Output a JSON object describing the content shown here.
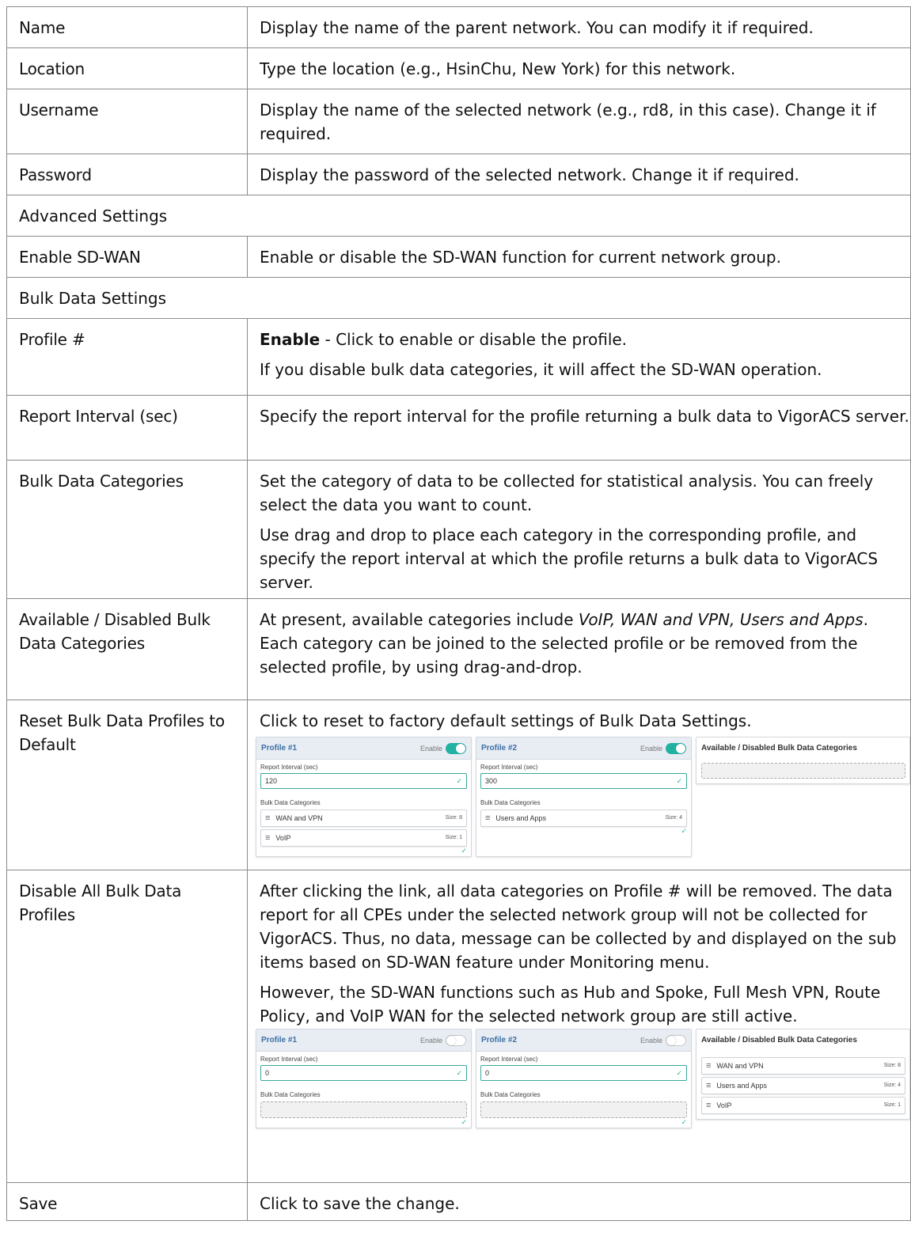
{
  "rows": [
    {
      "label": "Name",
      "desc": "Display the name of the parent network. You can modify it if required."
    },
    {
      "label": "Location",
      "desc": "Type the location (e.g., HsinChu, New York) for this network."
    },
    {
      "label": "Username",
      "desc": "Display the name of the selected network (e.g., rd8, in this case). Change it if required."
    },
    {
      "label": "Password",
      "desc": "Display the password of the selected network. Change it if required."
    },
    {
      "section": "Advanced Settings"
    },
    {
      "label": "Enable SD-WAN",
      "desc": "Enable or disable the SD-WAN function for current network group."
    },
    {
      "section": "Bulk Data Settings"
    },
    {
      "label": "Profile #",
      "desc_bold": "Enable",
      "desc_rest": " - Click to enable or disable the profile.",
      "desc2": "If you disable bulk data categories, it will affect the SD-WAN operation."
    },
    {
      "label": "Report Interval (sec)",
      "desc": "Specify the report interval for the profile returning a bulk data to VigorACS server."
    },
    {
      "label": "Bulk Data Categories",
      "desc": "Set the category of data to be collected for statistical analysis. You can freely select the data you want to count.",
      "desc2": "Use drag and drop to place each category in the corresponding profile, and specify the report interval at which the profile returns a bulk data to VigorACS server."
    },
    {
      "label": "Available / Disabled Bulk Data Categories",
      "desc_pre": "At present, available categories include ",
      "desc_italic": "VoIP, WAN and VPN, Users and Apps",
      "desc_post": ". Each category can be joined to the selected profile or be removed from the selected profile, by using drag-and-drop."
    },
    {
      "label": "Reset Bulk Data Profiles to Default",
      "desc": "Click to reset to factory default settings of Bulk Data Settings."
    },
    {
      "label": "Disable All Bulk Data Profiles",
      "desc": "After clicking the link, all data categories on Profile # will be removed. The data report for all CPEs under the selected network group will not be collected for VigorACS. Thus, no data, message can be collected by and displayed on the sub items based on SD-WAN feature under Monitoring menu.",
      "desc2": "However, the SD-WAN functions such as Hub and Spoke, Full Mesh VPN, Route Policy, and VoIP WAN for the selected network group are still active."
    },
    {
      "label": "Save",
      "desc": "Click to save the change."
    }
  ],
  "ui": {
    "enable_label": "Enable",
    "report_interval_label": "Report Interval (sec)",
    "bulk_categories_label": "Bulk Data Categories",
    "available_title": "Available / Disabled Bulk Data Categories",
    "check_glyph": "✓",
    "bars_glyph": "≡"
  },
  "shot_reset": {
    "profiles": [
      {
        "title": "Profile #1",
        "enabled": true,
        "interval": "120",
        "categories": [
          {
            "name": "WAN and VPN",
            "size": "Size: 8"
          },
          {
            "name": "VoIP",
            "size": "Size: 1"
          }
        ]
      },
      {
        "title": "Profile #2",
        "enabled": true,
        "interval": "300",
        "categories": [
          {
            "name": "Users and Apps",
            "size": "Size: 4"
          }
        ]
      }
    ],
    "available": []
  },
  "shot_disable": {
    "profiles": [
      {
        "title": "Profile #1",
        "enabled": false,
        "interval": "0",
        "categories": []
      },
      {
        "title": "Profile #2",
        "enabled": false,
        "interval": "0",
        "categories": []
      }
    ],
    "available": [
      {
        "name": "WAN and VPN",
        "size": "Size: 8"
      },
      {
        "name": "Users and Apps",
        "size": "Size: 4"
      },
      {
        "name": "VoIP",
        "size": "Size: 1"
      }
    ]
  },
  "colors": {
    "accent": "#21b2a2",
    "title_blue": "#3b6fa5",
    "header_bg": "#e8edf3",
    "border": "#8a8a8a"
  }
}
